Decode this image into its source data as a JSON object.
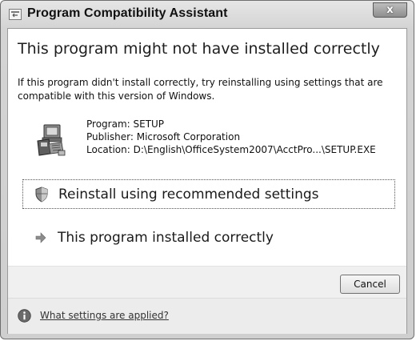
{
  "window": {
    "title": "Program Compatibility Assistant",
    "close_label": "x"
  },
  "main": {
    "headline": "This program might not have installed correctly",
    "description": "If this program didn't install correctly, try reinstalling using settings that are compatible with this version of Windows."
  },
  "program_info": {
    "program": "Program: SETUP",
    "publisher": "Publisher: Microsoft Corporation",
    "location": "Location: D:\\English\\OfficeSystem2007\\AcctPro...\\SETUP.EXE"
  },
  "options": [
    {
      "label": "Reinstall using recommended settings",
      "icon": "shield-icon"
    },
    {
      "label": "This program installed correctly",
      "icon": "arrow-right-icon"
    }
  ],
  "buttons": {
    "cancel_label": "Cancel"
  },
  "footer": {
    "help_link": "What settings are applied?",
    "icon": "info-icon"
  }
}
